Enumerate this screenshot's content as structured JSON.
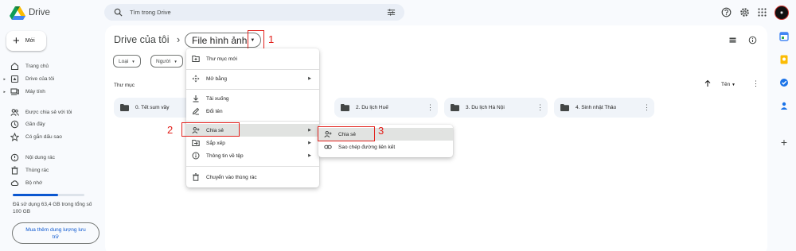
{
  "app": {
    "name": "Drive"
  },
  "search": {
    "placeholder": "Tìm trong Drive"
  },
  "sidebar": {
    "new_label": "Mới",
    "items": [
      {
        "label": "Trang chủ",
        "icon": "home-icon"
      },
      {
        "label": "Drive của tôi",
        "icon": "drive-icon"
      },
      {
        "label": "Máy tính",
        "icon": "computer-icon"
      },
      {
        "label": "Được chia sẻ với tôi",
        "icon": "shared-icon"
      },
      {
        "label": "Gần đây",
        "icon": "clock-icon"
      },
      {
        "label": "Có gắn dấu sao",
        "icon": "star-icon"
      },
      {
        "label": "Nội dung rác",
        "icon": "spam-icon"
      },
      {
        "label": "Thùng rác",
        "icon": "trash-icon"
      },
      {
        "label": "Bộ nhớ",
        "icon": "cloud-icon"
      }
    ],
    "storage": {
      "used_fraction": 0.634,
      "text": "Đã sử dụng 63,4 GB trong tổng số 100 GB"
    },
    "buy_label": "Mua thêm dung lượng lưu trữ"
  },
  "breadcrumb": {
    "root": "Drive của tôi",
    "separator": "›",
    "current": "File hình ảnh"
  },
  "filters": [
    {
      "label": "Loại"
    },
    {
      "label": "Người"
    }
  ],
  "section": {
    "title": "Thư mục"
  },
  "sort": {
    "label": "Tên"
  },
  "folders": [
    {
      "name": "0. Tết sum vầy"
    },
    {
      "name": "2. Du lịch Huế"
    },
    {
      "name": "3. Du lịch Hà Nội"
    },
    {
      "name": "4. Sinh nhật Thảo"
    }
  ],
  "context_menu": {
    "items": [
      {
        "label": "Thư mục mới",
        "icon": "new-folder-icon"
      },
      {
        "label": "Mở bằng",
        "icon": "open-with-icon",
        "submenu": true
      },
      {
        "label": "Tải xuống",
        "icon": "download-icon"
      },
      {
        "label": "Đổi tên",
        "icon": "rename-icon"
      },
      {
        "label": "Chia sẻ",
        "icon": "share-icon",
        "submenu": true,
        "highlighted": true
      },
      {
        "label": "Sắp xếp",
        "icon": "organize-icon",
        "submenu": true
      },
      {
        "label": "Thông tin về tệp",
        "icon": "info-icon",
        "submenu": true
      },
      {
        "label": "Chuyển vào thùng rác",
        "icon": "trash-icon"
      }
    ]
  },
  "share_submenu": {
    "items": [
      {
        "label": "Chia sẻ",
        "icon": "share-icon",
        "highlighted": true
      },
      {
        "label": "Sao chép đường liên kết",
        "icon": "link-icon"
      }
    ]
  },
  "annotations": [
    "1",
    "2",
    "3"
  ],
  "colors": {
    "accent": "#0b57d0",
    "annotation": "#e2211c",
    "background": "#f8fafd"
  }
}
